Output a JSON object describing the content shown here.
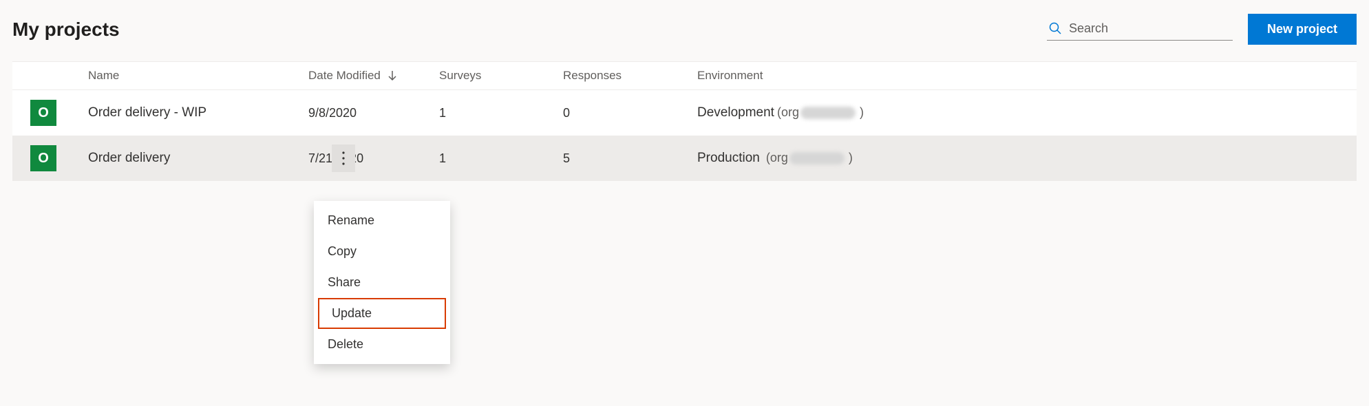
{
  "header": {
    "title": "My projects",
    "search_placeholder": "Search",
    "new_project_label": "New project"
  },
  "table": {
    "columns": {
      "name": "Name",
      "date_modified": "Date Modified",
      "surveys": "Surveys",
      "responses": "Responses",
      "environment": "Environment"
    },
    "sort_column": "date_modified",
    "sort_direction": "desc"
  },
  "rows": [
    {
      "icon_letter": "O",
      "name": "Order delivery - WIP",
      "date_modified": "9/8/2020",
      "surveys": "1",
      "responses": "0",
      "environment": "Development",
      "org_prefix": "(org",
      "org_suffix": ")"
    },
    {
      "icon_letter": "O",
      "name": "Order delivery",
      "date_modified": "7/21/2020",
      "surveys": "1",
      "responses": "5",
      "environment": "Production",
      "org_prefix": " (org",
      "org_suffix": ")"
    }
  ],
  "context_menu": {
    "items": [
      {
        "label": "Rename"
      },
      {
        "label": "Copy"
      },
      {
        "label": "Share"
      },
      {
        "label": "Update",
        "highlighted": true
      },
      {
        "label": "Delete"
      }
    ]
  }
}
